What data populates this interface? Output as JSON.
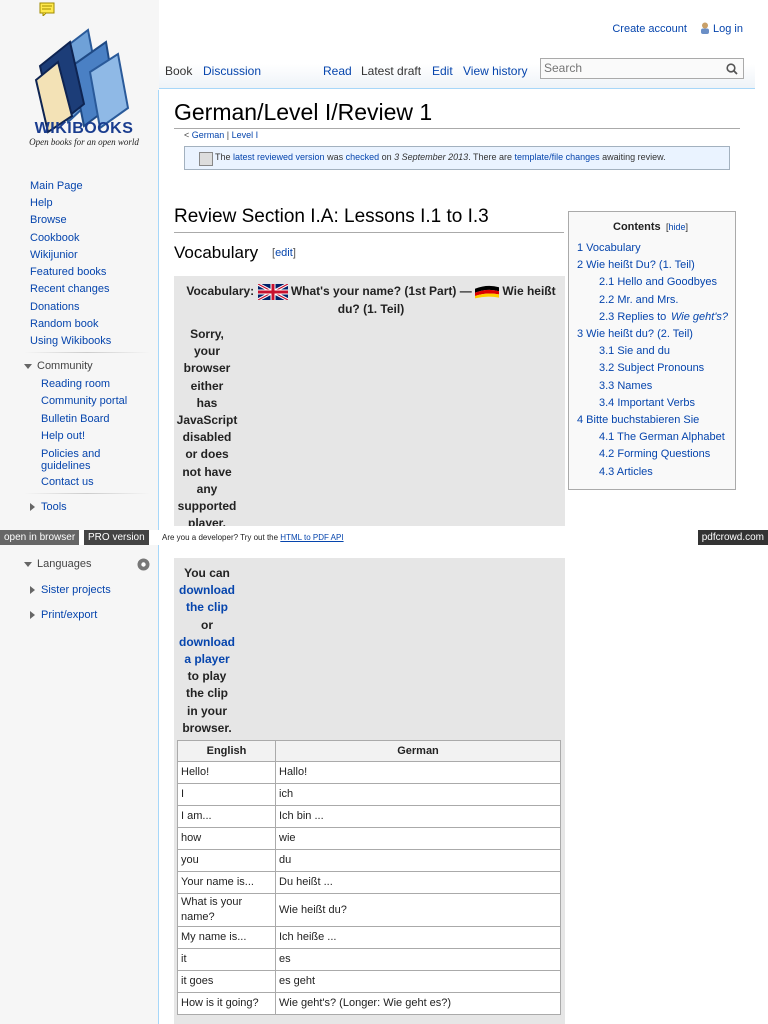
{
  "personal": {
    "create_account": "Create account",
    "login": "Log in"
  },
  "logo": {
    "name": "WIKIBOOKS",
    "tagline": "Open books for an open world"
  },
  "tabs": {
    "book": "Book",
    "discussion": "Discussion",
    "read": "Read",
    "latest": "Latest draft",
    "edit": "Edit",
    "history": "View history"
  },
  "search": {
    "placeholder": "Search"
  },
  "nav": [
    "Main Page",
    "Help",
    "Browse",
    "Cookbook",
    "Wikijunior",
    "Featured books",
    "Recent changes",
    "Donations",
    "Random book",
    "Using Wikibooks"
  ],
  "community": {
    "heading": "Community",
    "items": [
      "Reading room",
      "Community portal",
      "Bulletin Board",
      "Help out!",
      "Policies and guidelines",
      "Contact us"
    ]
  },
  "portals": {
    "tools": "Tools",
    "languages": "Languages",
    "sister": "Sister projects",
    "print": "Print/export"
  },
  "page": {
    "title": "German/Level I/Review 1",
    "crumb_prefix": "< ",
    "crumb_german": "German",
    "crumb_sep": " | ",
    "crumb_level": "Level I",
    "flagged": {
      "t1": "The ",
      "link1": "latest reviewed version",
      "t2": " was ",
      "link2": "checked",
      "t3": " on ",
      "date": "3 September 2013",
      "t4": ". There are ",
      "link3": "template/file changes",
      "t5": " awaiting review."
    },
    "section": "Review Section I.A: Lessons I.1 to I.3",
    "subsection": "Vocabulary",
    "edit_open": "[",
    "edit_link": "edit",
    "edit_close": "]"
  },
  "toc": {
    "title": "Contents",
    "hide_open": "[",
    "hide": "hide",
    "hide_close": "]",
    "items": [
      {
        "text": "1 Vocabulary",
        "level": 1
      },
      {
        "text": "2 Wie heißt Du? (1. Teil)",
        "level": 1
      },
      {
        "text": "2.1 Hello and Goodbyes",
        "level": 2
      },
      {
        "text": "2.2 Mr. and Mrs.",
        "level": 2
      },
      {
        "text": "2.3 Replies to ",
        "em": "Wie geht's?",
        "level": 2
      },
      {
        "text": "3 Wie heißt du? (2. Teil)",
        "level": 1
      },
      {
        "text": "3.1 Sie and du",
        "level": 2
      },
      {
        "text": "3.2 Subject Pronouns",
        "level": 2
      },
      {
        "text": "3.3 Names",
        "level": 2
      },
      {
        "text": "3.4 Important Verbs",
        "level": 2
      },
      {
        "text": "4 Bitte buchstabieren Sie",
        "level": 1
      },
      {
        "text": "4.1 The German Alphabet",
        "level": 2
      },
      {
        "text": "4.2 Forming Questions",
        "level": 2
      },
      {
        "text": "4.3 Articles",
        "level": 2
      }
    ]
  },
  "vocab": {
    "label": "Vocabulary: ",
    "title_en": "What's your name? (1st Part) — ",
    "title_de": "Wie heißt du? (1. Teil)",
    "sorry_top": [
      "Sorry,",
      "your",
      "browser",
      "either",
      "has",
      "JavaScript",
      "disabled",
      "or does",
      "not have",
      "any",
      "supported",
      "player."
    ],
    "sorry_bottom": [
      {
        "text": "You can",
        "link": false
      },
      {
        "text": "download",
        "link": true
      },
      {
        "text": "the clip",
        "link": true
      },
      {
        "text": "or",
        "link": false
      },
      {
        "text": "download",
        "link": true
      },
      {
        "text": "a player",
        "link": true
      },
      {
        "text": "to play",
        "link": false
      },
      {
        "text": "the clip",
        "link": false
      },
      {
        "text": "in your",
        "link": false
      },
      {
        "text": "browser.",
        "link": false
      }
    ],
    "columns": [
      "English",
      "German"
    ],
    "rows": [
      [
        "Hello!",
        "Hallo!"
      ],
      [
        "I",
        "ich"
      ],
      [
        "I am...",
        "Ich bin ..."
      ],
      [
        "how",
        "wie"
      ],
      [
        "you",
        "du"
      ],
      [
        "Your name is...",
        "Du heißt ..."
      ],
      [
        "What is your name?",
        "Wie heißt du?"
      ],
      [
        "My name is...",
        "Ich heiße ..."
      ],
      [
        "it",
        "es"
      ],
      [
        "it goes",
        "es geht"
      ],
      [
        "How is it going?",
        "Wie geht's? (Longer: Wie geht es?)"
      ]
    ]
  },
  "pdfbar": {
    "open": "open in browser",
    "pro": "PRO version",
    "msg": "Are you a developer? Try out the ",
    "api": "HTML to PDF API",
    "brand": "pdfcrowd.com"
  }
}
